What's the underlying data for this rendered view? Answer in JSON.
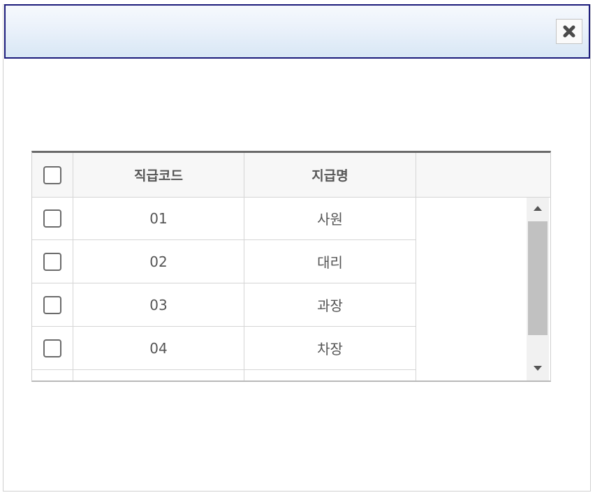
{
  "dialog": {
    "title": "",
    "close_icon": "close-x-icon"
  },
  "grid": {
    "columns": {
      "checkbox": "",
      "code": "직급코드",
      "name": "지급명",
      "extra": ""
    },
    "rows": [
      {
        "code": "01",
        "name": "사원",
        "checked": false
      },
      {
        "code": "02",
        "name": "대리",
        "checked": false
      },
      {
        "code": "03",
        "name": "과장",
        "checked": false
      },
      {
        "code": "04",
        "name": "차장",
        "checked": false
      }
    ],
    "scroll_icons": [
      "scroll-up-arrow-icon",
      "scroll-down-arrow-icon"
    ]
  },
  "colors": {
    "title_border": "#1a1a7a",
    "header_rule": "#6a6a6a",
    "scroll_thumb": "#c1c1c1"
  }
}
